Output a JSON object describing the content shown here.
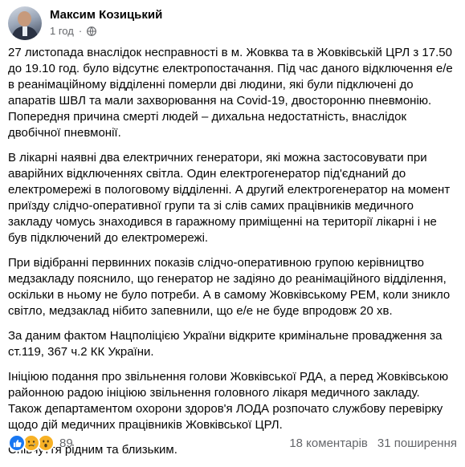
{
  "post": {
    "author": "Максим Козицький",
    "time": "1 год",
    "dot": "·",
    "privacy_icon": "globe-icon",
    "paragraphs": [
      "27 листопада внаслідок несправності в м. Жовква та в Жовківській ЦРЛ з 17.50\nдо 19.10 год. було відсутнє електропостачання. Під час даного відключення е/е\nв реанімаційному відділенні померли дві людини, які були підключені до\nапаратів ШВЛ та мали захворювання на Covid-19, двосторонню пневмонію.\nПопередня причина смерті людей – дихальна недостатність, внаслідок\nдвобічної пневмонії.",
      "В лікарні наявні два електричних генератори, які можна застосовувати при\nаварійних відключеннях світла. Один електрогенератор під'єднаний до\nелектромережі в пологовому відділенні. А другий електрогенератор на момент\nприїзду слідчо-оперативної групи та зі слів самих працівників медичного\nзакладу чомусь знаходився в гаражному приміщенні на території лікарні і не\nбув підключений до електромережі.",
      "При відібранні первинних показів слідчо-оперативною групою керівництво\nмедзакладу пояснило, що генератор не задіяно до реанімаційного відділення,\nоскільки в ньому не було потреби. А в самому Жовківському РЕМ, коли зникло\nсвітло, медзаклад нібито запевнили, що е/е не буде впродовж 20 хв.",
      "За даним фактом Нацполіцією України відкрите кримінальне провадження за\nст.119, 367 ч.2 КК України.",
      "Ініціюю подання про звільнення голови Жовківської РДА, а перед Жовківською\nрайонною радою ініціюю звільнення головного лікаря медичного закладу.\nТакож департаментом охорони здоров'я ЛОДА розпочато службову перевірку\nщодо дій медичних працівників Жовківської ЦРЛ.",
      "Співчуття рідним та близьким."
    ]
  },
  "footer": {
    "reactions": [
      "like-icon",
      "sad-icon",
      "wow-icon"
    ],
    "reaction_count": "89",
    "comments": "18 коментарів",
    "shares": "31 поширення"
  },
  "colors": {
    "text": "#050505",
    "secondary": "#65676b",
    "like": "#1877f2",
    "emoji": "#f7b125"
  }
}
